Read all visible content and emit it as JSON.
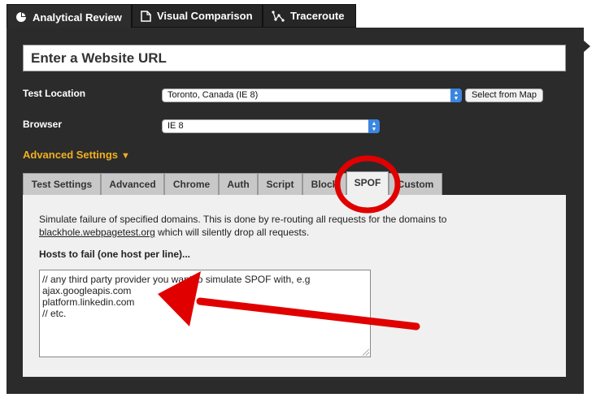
{
  "top_tabs": [
    {
      "label": "Analytical Review",
      "icon": "pie-chart-icon",
      "active": true
    },
    {
      "label": "Visual Comparison",
      "icon": "document-icon",
      "active": false
    },
    {
      "label": "Traceroute",
      "icon": "route-icon",
      "active": false
    }
  ],
  "url_field": {
    "placeholder": "Enter a Website URL"
  },
  "test_location": {
    "label": "Test Location",
    "value": "Toronto, Canada (IE 8)",
    "map_button": "Select from Map"
  },
  "browser": {
    "label": "Browser",
    "value": "IE 8"
  },
  "advanced": {
    "label": "Advanced Settings",
    "toggle_icon": "triangle-down-icon"
  },
  "settings_tabs": [
    {
      "label": "Test Settings"
    },
    {
      "label": "Advanced"
    },
    {
      "label": "Chrome"
    },
    {
      "label": "Auth"
    },
    {
      "label": "Script"
    },
    {
      "label": "Block"
    },
    {
      "label": "SPOF"
    },
    {
      "label": "Custom"
    }
  ],
  "spof": {
    "description_1": "Simulate failure of specified domains. This is done by re-routing all requests for the domains to",
    "description_link": "blackhole.webpagetest.org",
    "description_2": " which will silently drop all requests.",
    "hosts_label": "Hosts to fail (one host per line)...",
    "hosts_lines": [
      "// any third party provider you want to simulate SPOF with, e.g",
      "ajax.googleapis.com",
      "platform.linkedin.com",
      "// etc."
    ]
  },
  "annotations": {
    "circle_color": "#e00000",
    "arrow_color": "#e00000"
  },
  "colors": {
    "panel": "#2b2b2b",
    "accent": "#f2b01e",
    "stepper": "#3b86e0"
  }
}
